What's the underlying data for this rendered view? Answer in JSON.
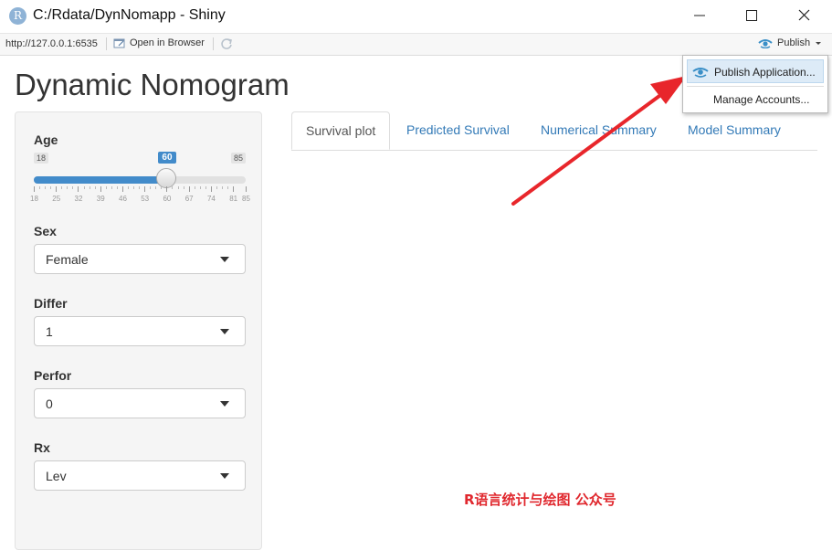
{
  "window": {
    "title": "C:/Rdata/DynNomapp - Shiny",
    "logo_letter": "R"
  },
  "toolbar": {
    "url": "http://127.0.0.1:6535",
    "open_in_browser": "Open in Browser",
    "publish": "Publish"
  },
  "page": {
    "title": "Dynamic Nomogram"
  },
  "inputs": {
    "age": {
      "label": "Age",
      "min": 18,
      "max": 85,
      "value": 60,
      "ticks": [
        "18",
        "25",
        "32",
        "39",
        "46",
        "53",
        "60",
        "67",
        "74",
        "81",
        "85"
      ]
    },
    "sex": {
      "label": "Sex",
      "value": "Female"
    },
    "differ": {
      "label": "Differ",
      "value": "1"
    },
    "perfor": {
      "label": "Perfor",
      "value": "0"
    },
    "rx": {
      "label": "Rx",
      "value": "Lev"
    }
  },
  "tabs": [
    {
      "label": "Survival plot",
      "active": true
    },
    {
      "label": "Predicted Survival",
      "active": false
    },
    {
      "label": "Numerical Summary",
      "active": false
    },
    {
      "label": "Model Summary",
      "active": false
    }
  ],
  "publish_menu": {
    "items": [
      {
        "label": "Publish Application...",
        "highlighted": true
      },
      {
        "label": "Manage Accounts...",
        "highlighted": false
      }
    ]
  },
  "watermark": "R语言统计与绘图 公众号",
  "colors": {
    "accent": "#428bca",
    "link": "#337ab7",
    "arrow": "#e8262b",
    "watermark": "#e0282e"
  }
}
